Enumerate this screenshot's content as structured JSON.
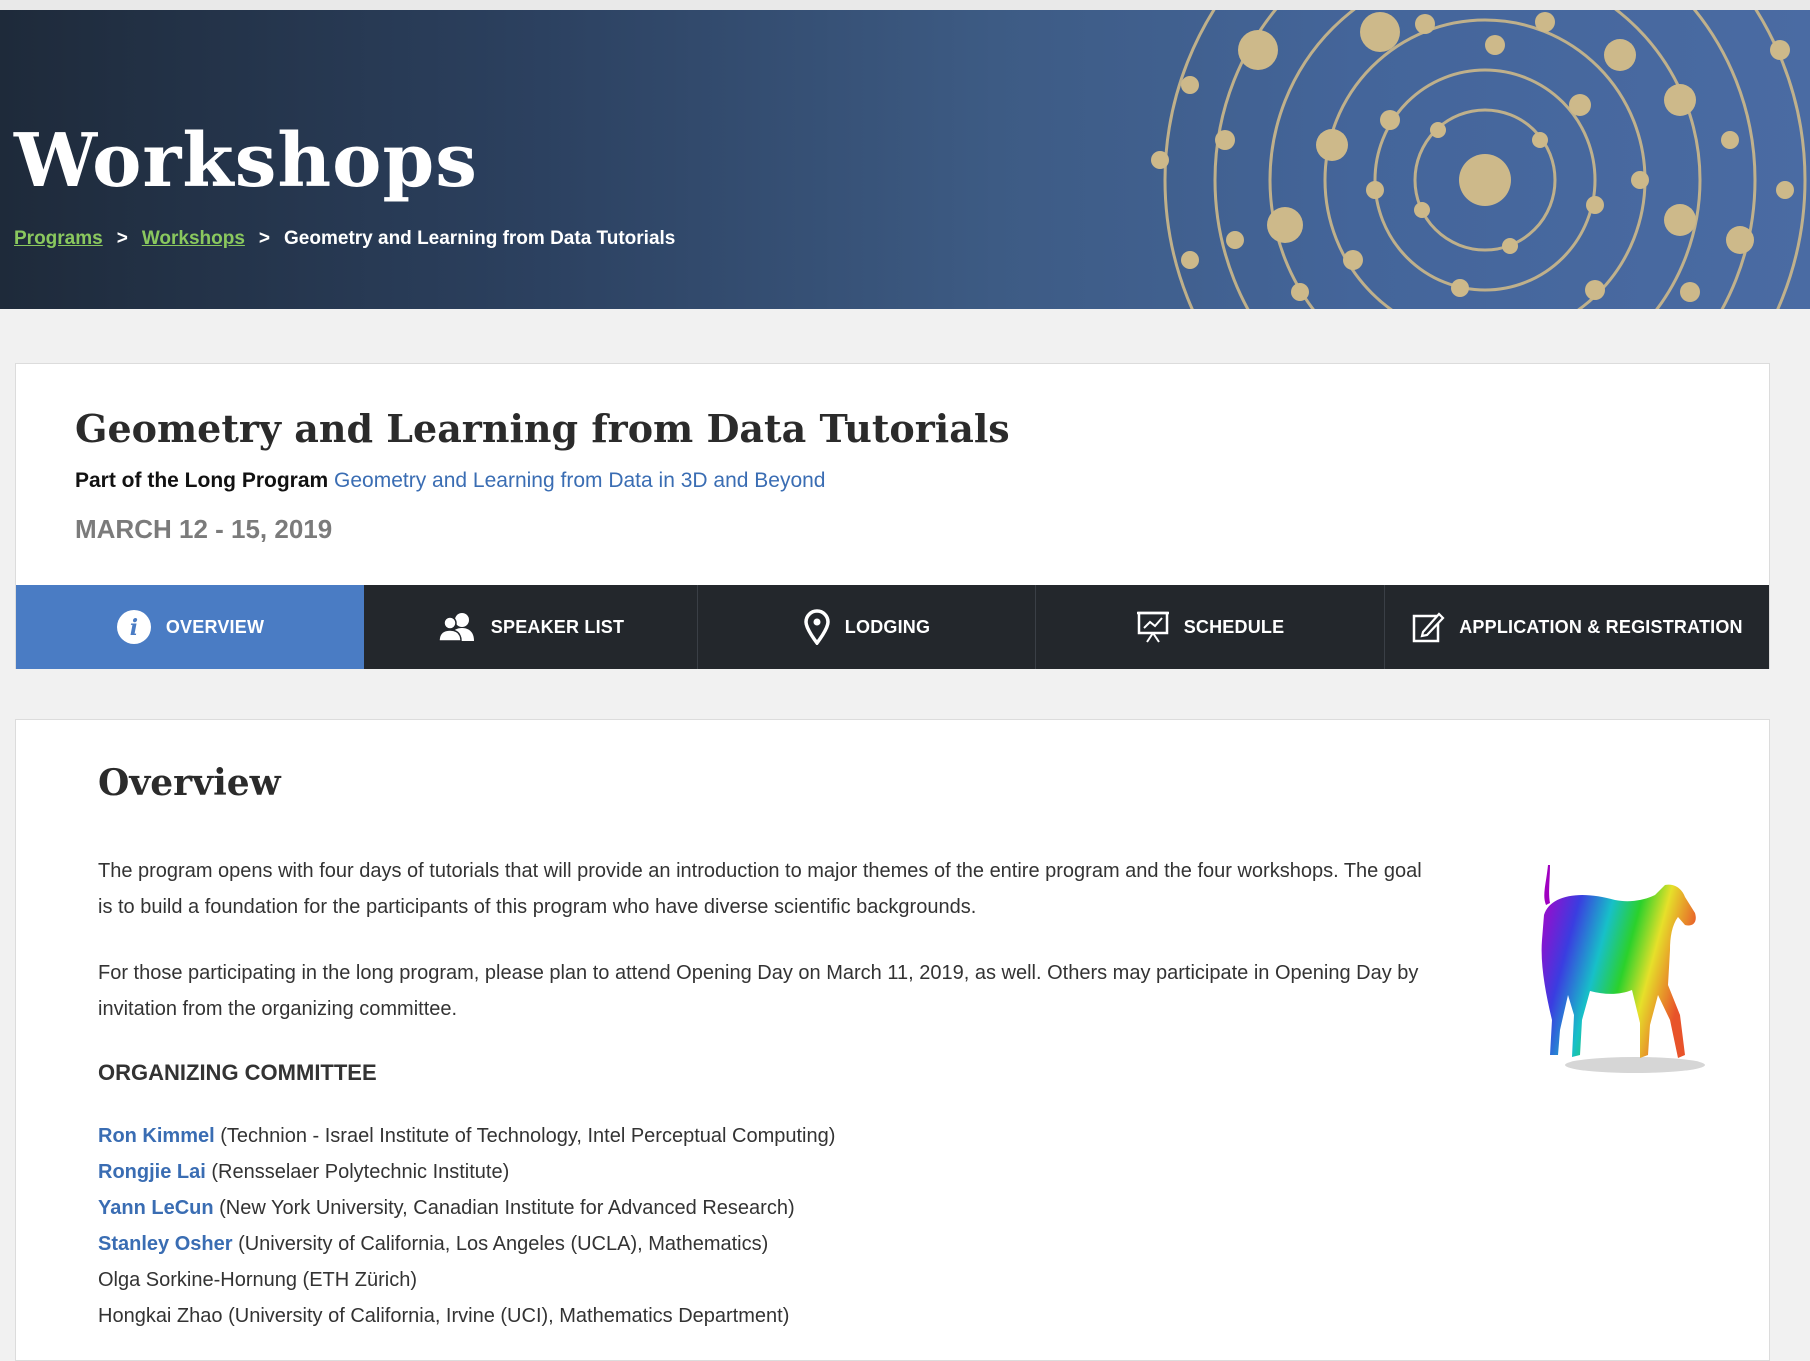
{
  "header": {
    "title": "Workshops",
    "breadcrumb": {
      "programs": "Programs",
      "workshops": "Workshops",
      "current": "Geometry and Learning from Data Tutorials",
      "separator": ">"
    }
  },
  "workshop": {
    "title": "Geometry and Learning from Data Tutorials",
    "part_of_label": "Part of the Long Program",
    "program_link": "Geometry and Learning from Data in 3D and Beyond",
    "dates": "MARCH 12 - 15, 2019"
  },
  "tabs": [
    {
      "label": "OVERVIEW",
      "icon": "info-icon",
      "active": true
    },
    {
      "label": "SPEAKER LIST",
      "icon": "people-icon",
      "active": false
    },
    {
      "label": "LODGING",
      "icon": "map-pin-icon",
      "active": false
    },
    {
      "label": "SCHEDULE",
      "icon": "presentation-board-icon",
      "active": false
    },
    {
      "label": "APPLICATION & REGISTRATION",
      "icon": "edit-icon",
      "active": false
    }
  ],
  "overview": {
    "heading": "Overview",
    "paragraph1": "The program opens with four days of tutorials that will provide an introduction to major themes of the entire program and the four workshops. The goal is to build a foundation for the participants of this program who have diverse scientific backgrounds.",
    "paragraph2": "For those participating in the long program, please plan to attend Opening Day on March 11, 2019, as well.  Others may participate in Opening Day by invitation from the organizing committee.",
    "committee_heading": "ORGANIZING COMMITTEE",
    "members": [
      {
        "name": "Ron Kimmel",
        "affiliation": " (Technion - Israel Institute of Technology, Intel Perceptual Computing)",
        "linked": true
      },
      {
        "name": "Rongjie Lai",
        "affiliation": " (Rensselaer Polytechnic Institute)",
        "linked": true
      },
      {
        "name": "Yann LeCun",
        "affiliation": " (New York University, Canadian Institute for Advanced Research)",
        "linked": true
      },
      {
        "name": "Stanley Osher",
        "affiliation": " (University of California, Los Angeles (UCLA), Mathematics)",
        "linked": true
      },
      {
        "name": "Olga Sorkine-Hornung",
        "affiliation": " (ETH Zürich)",
        "linked": false
      },
      {
        "name": "Hongkai Zhao",
        "affiliation": " (University of California, Irvine (UCI), Mathematics Department)",
        "linked": false
      }
    ]
  },
  "colors": {
    "link_green": "#8ac85e",
    "link_blue": "#3a6db3",
    "tab_active": "#4a7cc4",
    "tab_dark": "#23272c",
    "banner_dot": "#cdb98a"
  }
}
